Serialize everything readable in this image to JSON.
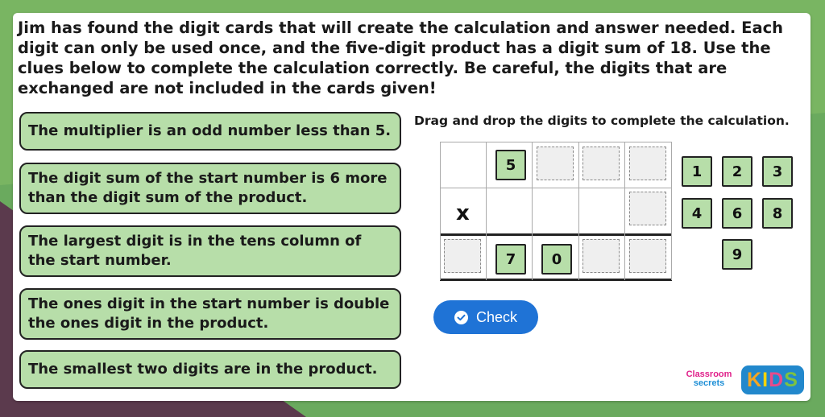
{
  "question": "Jim has found the digit cards that will create the calculation and answer needed. Each digit can only be used once, and the five-digit product has a digit sum of 18. Use the clues below to complete the calculation correctly. Be careful, the digits that are exchanged are not included in the cards given!",
  "clues": [
    "The multiplier is an odd number less than 5.",
    "The digit sum of the start number is 6 more than the digit sum of the product.",
    "The largest digit is in the tens column of the start number.",
    "The ones digit in the start number is double the ones digit in the product.",
    "The smallest two digits are in the product."
  ],
  "instruction": "Drag and drop the digits to complete the calculation.",
  "calculation": {
    "operator": "x",
    "start_given": "5",
    "product_given": [
      "7",
      "0"
    ]
  },
  "cards": [
    "1",
    "2",
    "3",
    "4",
    "6",
    "8",
    "9"
  ],
  "check_label": "Check",
  "logo": {
    "classroom": "Classroom",
    "secrets": "secrets",
    "kids": "KIDS",
    "kids_colors": [
      "#f6a623",
      "#ffd400",
      "#e94b8a",
      "#7ec242"
    ]
  }
}
